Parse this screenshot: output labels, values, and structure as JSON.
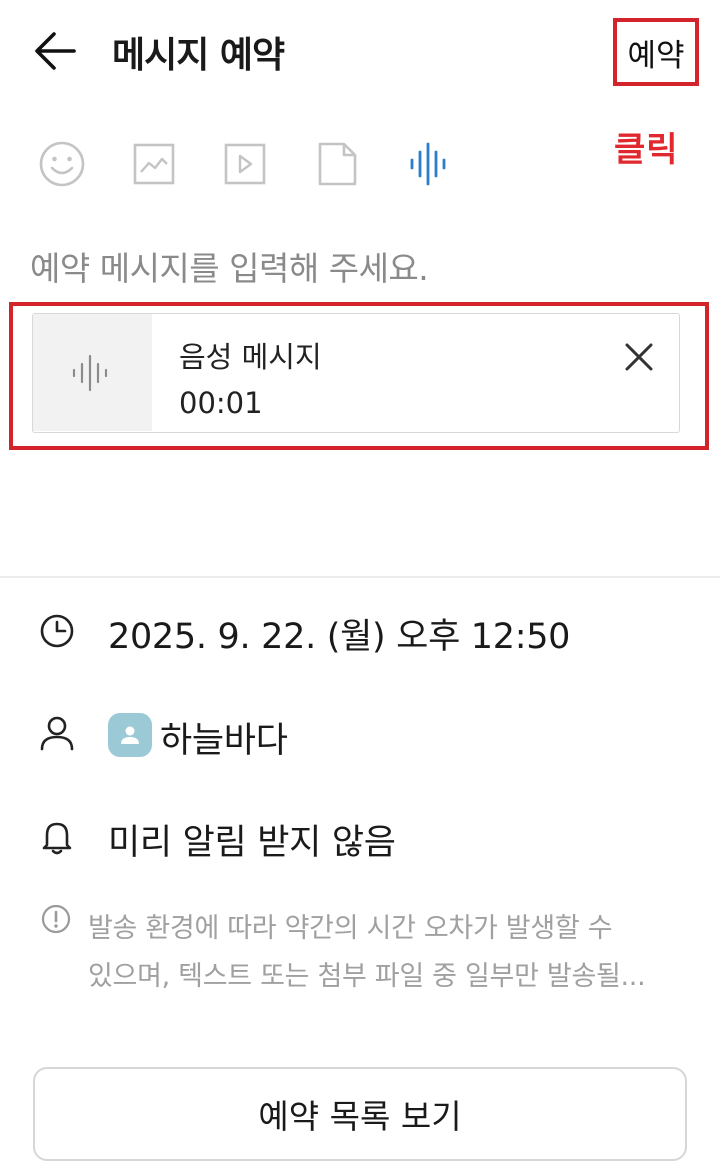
{
  "header": {
    "title": "메시지 예약",
    "reserve_label": "예약",
    "click_annotation": "클릭"
  },
  "toolbar": {
    "icons": [
      "emoji-icon",
      "image-icon",
      "video-icon",
      "file-icon",
      "voice-icon"
    ],
    "active": "voice-icon",
    "active_color": "#2a7fd0",
    "inactive_color": "#c4c4c4"
  },
  "compose": {
    "placeholder": "예약 메시지를 입력해 주세요."
  },
  "attachment": {
    "name": "음성 메시지",
    "duration": "00:01"
  },
  "schedule": {
    "datetime": "2025. 9. 22. (월) 오후 12:50",
    "recipient": "하늘바다",
    "reminder": "미리 알림 받지 않음"
  },
  "notice": {
    "line1": "발송 환경에 따라 약간의 시간 오차가 발생할 수",
    "line2": "있으며, 텍스트 또는 첨부 파일 중 일부만 발송될..."
  },
  "footer": {
    "list_button": "예약 목록 보기"
  },
  "colors": {
    "highlight": "#d4242b",
    "annotation": "#e0282e",
    "avatar_bg": "#9cc9d6"
  }
}
